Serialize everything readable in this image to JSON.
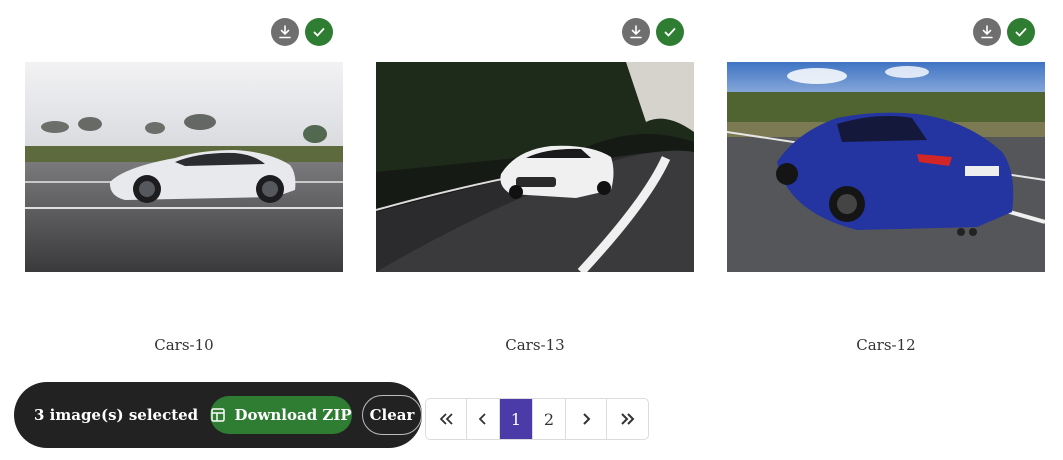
{
  "cards": [
    {
      "name": "Cars-10"
    },
    {
      "name": "Cars-13"
    },
    {
      "name": "Cars-12"
    }
  ],
  "icons": {
    "download": "download-icon",
    "selected": "check-icon"
  },
  "colors": {
    "selected_green": "#2e7d32",
    "download_grey": "#6f6f6f",
    "active_page": "#4a3ba8",
    "bar_bg": "#222222"
  },
  "selection": {
    "text": "3 image(s) selected",
    "download_label": "Download ZIP",
    "clear_label": "Clear"
  },
  "pagination": {
    "current": "1",
    "pages": [
      "1",
      "2"
    ]
  }
}
